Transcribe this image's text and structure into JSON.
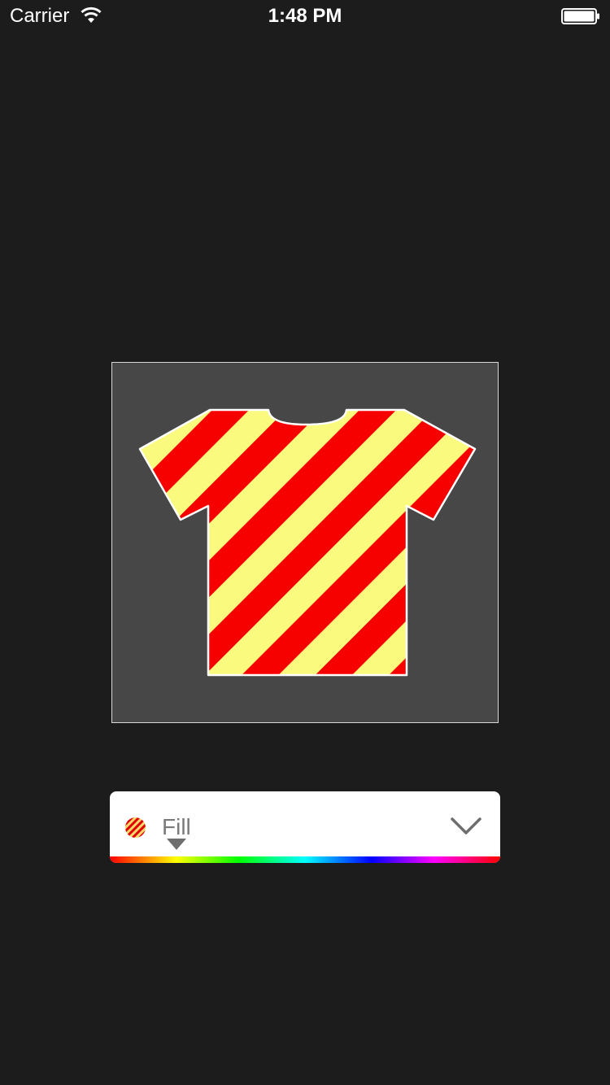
{
  "status_bar": {
    "carrier": "Carrier",
    "time": "1:48 PM",
    "wifi_icon": "wifi-icon",
    "battery_icon": "battery-icon"
  },
  "preview": {
    "background_color": "#474747",
    "shirt": {
      "pattern": "diagonal-stripes",
      "stripe_colors": [
        "#f70000",
        "#fafa7f"
      ],
      "outline_color": "#ffffff"
    }
  },
  "fill_control": {
    "label": "Fill",
    "swatch_icon": "striped-swatch-icon",
    "caret_icon": "caret-down-icon",
    "expand_icon": "chevron-down-icon",
    "spectrum_colors": [
      "#ff0000",
      "#ffff00",
      "#00ff00",
      "#00ffff",
      "#0000ff",
      "#ff00ff",
      "#ff0000"
    ]
  }
}
